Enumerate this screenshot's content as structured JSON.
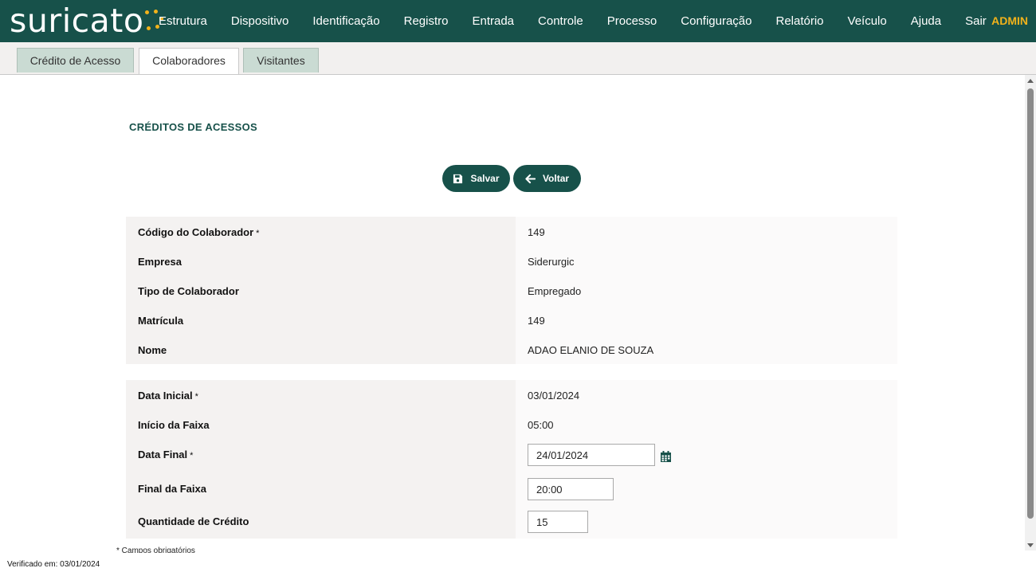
{
  "app": {
    "logo_text": "suricato",
    "user": "ADMIN"
  },
  "nav": [
    "Estrutura",
    "Dispositivo",
    "Identificação",
    "Registro",
    "Entrada",
    "Controle",
    "Processo",
    "Configuração",
    "Relatório",
    "Veículo",
    "Ajuda",
    "Sair"
  ],
  "tabs": [
    {
      "label": "Crédito de Acesso",
      "active": false
    },
    {
      "label": "Colaboradores",
      "active": true
    },
    {
      "label": "Visitantes",
      "active": false
    }
  ],
  "page": {
    "title": "CRÉDITOS DE ACESSOS",
    "save_label": "Salvar",
    "back_label": "Voltar",
    "required_mark": "*",
    "footnote": "* Campos obrigatórios",
    "verified": "Verificado em: 03/01/2024"
  },
  "collaborator": {
    "codigo": {
      "label": "Código do Colaborador",
      "value": "149"
    },
    "empresa": {
      "label": "Empresa",
      "value": "Siderurgic"
    },
    "tipo": {
      "label": "Tipo de Colaborador",
      "value": "Empregado"
    },
    "matricula": {
      "label": "Matrícula",
      "value": "149"
    },
    "nome": {
      "label": "Nome",
      "value": "ADAO ELANIO DE SOUZA"
    }
  },
  "credit": {
    "data_inicial": {
      "label": "Data Inicial",
      "value": "03/01/2024"
    },
    "inicio_faixa": {
      "label": "Início da Faixa",
      "value": "05:00"
    },
    "data_final": {
      "label": "Data Final",
      "value": "24/01/2024"
    },
    "final_faixa": {
      "label": "Final da Faixa",
      "value": "20:00"
    },
    "quantidade": {
      "label": "Quantidade de Crédito",
      "value": "15"
    }
  },
  "colors": {
    "brand": "#17514a",
    "accent": "#f2b21b"
  },
  "icons": {
    "save": "floppy-disk-icon",
    "back": "arrow-left-icon",
    "calendar": "calendar-icon"
  }
}
